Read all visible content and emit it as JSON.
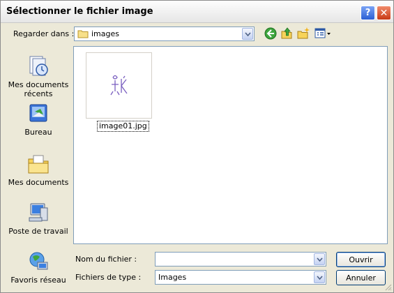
{
  "window": {
    "title": "Sélectionner le fichier image",
    "help_label": "?",
    "close_label": "✕"
  },
  "toolbar": {
    "look_in_label": "Regarder dans :",
    "look_in_value": "images",
    "icons": [
      "back-icon",
      "up-folder-icon",
      "new-folder-icon",
      "views-menu-icon"
    ]
  },
  "places": [
    {
      "label": "Mes documents récents",
      "icon": "recent-documents-icon"
    },
    {
      "label": "Bureau",
      "icon": "desktop-icon"
    },
    {
      "label": "Mes documents",
      "icon": "my-documents-icon"
    },
    {
      "label": "Poste de travail",
      "icon": "my-computer-icon"
    },
    {
      "label": "Favoris réseau",
      "icon": "network-places-icon"
    }
  ],
  "files": [
    {
      "name": "image01.jpg",
      "selected": true
    }
  ],
  "form": {
    "filename_label": "Nom du fichier :",
    "filename_value": "",
    "filetype_label": "Fichiers de type :",
    "filetype_value": "Images"
  },
  "buttons": {
    "ok_label": "Ouvrir",
    "cancel_label": "Annuler"
  },
  "colors": {
    "dialog_bg": "#ece9d8",
    "field_border": "#7f9db9",
    "close_red": "#c83a16",
    "help_blue": "#2b5fd4"
  }
}
